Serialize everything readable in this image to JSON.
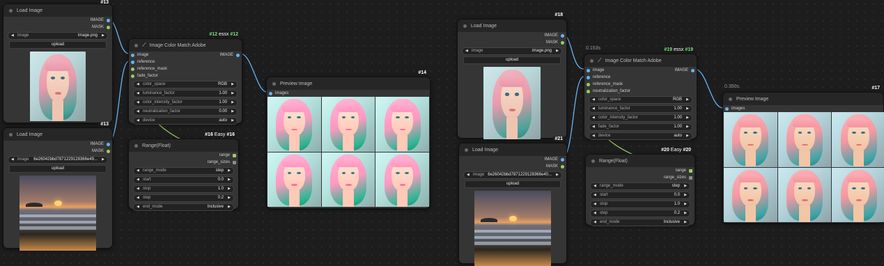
{
  "nodes": {
    "load1": {
      "title": "Load Image",
      "id": "#13",
      "outputs": [
        "IMAGE",
        "MASK"
      ],
      "image_label": "image",
      "image_value": "image.png",
      "upload": "upload"
    },
    "load2": {
      "title": "Load Image",
      "id": "#13",
      "outputs": [
        "IMAGE",
        "MASK"
      ],
      "image_label": "image",
      "image_value": "6e26042bbd7871229128366e49...",
      "upload": "upload"
    },
    "match1": {
      "title": "Image Color Match Adobe",
      "id_prefix": "#12",
      "id_tag": "essx",
      "id": "#12",
      "inputs": [
        "image",
        "reference",
        "reference_mask",
        "fade_factor"
      ],
      "output": "IMAGE",
      "widgets": [
        {
          "label": "color_space",
          "value": "RGB"
        },
        {
          "label": "luminance_factor",
          "value": "1.00"
        },
        {
          "label": "color_intensity_factor",
          "value": "1.00"
        },
        {
          "label": "neutralization_factor",
          "value": "0.00"
        },
        {
          "label": "device",
          "value": "auto"
        }
      ]
    },
    "range1": {
      "title": "Range(Float)",
      "id_prefix": "#16",
      "id_tag": "Easy",
      "id": "#16",
      "outputs": [
        "range",
        "range_sizes"
      ],
      "widgets": [
        {
          "label": "range_mode",
          "value": "step"
        },
        {
          "label": "start",
          "value": "0.0"
        },
        {
          "label": "stop",
          "value": "1.0"
        },
        {
          "label": "step",
          "value": "0.2"
        },
        {
          "label": "end_mode",
          "value": "Inclusive"
        }
      ]
    },
    "preview1": {
      "title": "Preview Image",
      "id": "#14",
      "input": "images"
    },
    "load3": {
      "title": "Load Image",
      "id": "#18",
      "outputs": [
        "IMAGE",
        "MASK"
      ],
      "image_label": "image",
      "image_value": "image.png",
      "upload": "upload"
    },
    "load4": {
      "title": "Load Image",
      "id": "#21",
      "outputs": [
        "IMAGE",
        "MASK"
      ],
      "image_label": "image",
      "image_value": "6e26042bbd7871229128366e40...",
      "upload": "upload"
    },
    "match2": {
      "title": "Image Color Match Adobe",
      "timing": "0.153s",
      "id_prefix": "#19",
      "id_tag": "essx",
      "id": "#19",
      "inputs": [
        "image",
        "reference",
        "reference_mask",
        "neutralization_factor"
      ],
      "output": "IMAGE",
      "widgets": [
        {
          "label": "color_space",
          "value": "RGB"
        },
        {
          "label": "luminance_factor",
          "value": "1.00"
        },
        {
          "label": "color_intensity_factor",
          "value": "1.00"
        },
        {
          "label": "fade_factor",
          "value": "1.00"
        },
        {
          "label": "device",
          "value": "auto"
        }
      ]
    },
    "range2": {
      "title": "Range(Float)",
      "id_prefix": "#20",
      "id_tag": "Easy",
      "id": "#20",
      "outputs": [
        "range",
        "range_sizes"
      ],
      "widgets": [
        {
          "label": "range_mode",
          "value": "step"
        },
        {
          "label": "start",
          "value": "0.0"
        },
        {
          "label": "stop",
          "value": "1.0"
        },
        {
          "label": "step",
          "value": "0.2"
        },
        {
          "label": "end_mode",
          "value": "Inclusive"
        }
      ]
    },
    "preview2": {
      "title": "Preview Image",
      "timing": "0.350s",
      "id": "#17",
      "input": "images"
    }
  },
  "colors": {
    "canvas": "#1d1d1d",
    "node_body": "#353535",
    "node_header": "#262626",
    "image_wire": "#64b5f6",
    "float_wire": "#9ccc65",
    "badge_green": "#7de07d"
  },
  "icons": {
    "wand": "magic-wand-icon",
    "collapse": "node-collapse-dot-icon",
    "arrow_left": "triangle-left-icon",
    "arrow_right": "triangle-right-icon"
  }
}
